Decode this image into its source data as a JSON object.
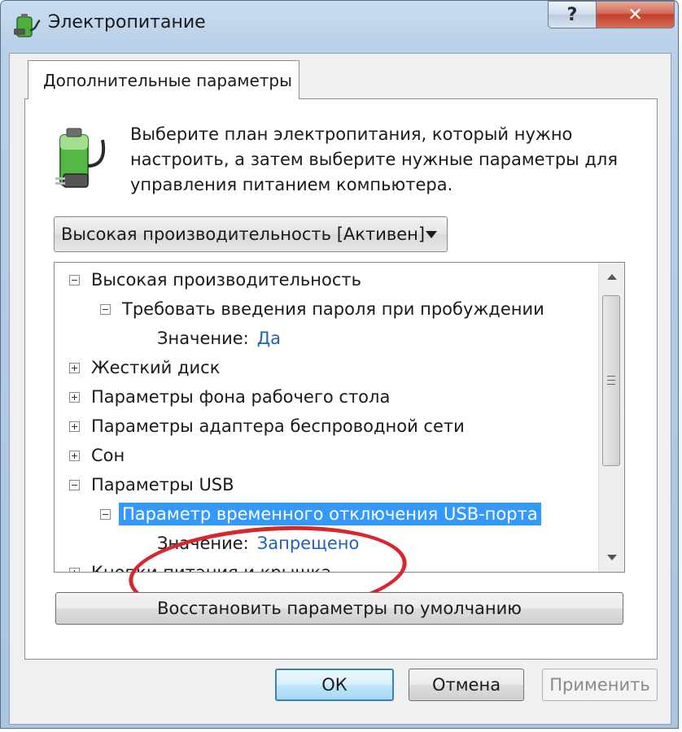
{
  "window": {
    "title": "Электропитание",
    "help_label": "?",
    "close_label": "✕"
  },
  "tab": {
    "label": "Дополнительные параметры"
  },
  "description": "Выберите план электропитания, который нужно настроить, а затем выберите нужные параметры для управления питанием компьютера.",
  "plan_select": {
    "selected": "Высокая производительность [Активен]"
  },
  "tree": {
    "items": [
      {
        "label": "Высокая производительность",
        "expanded": true,
        "level": 0
      },
      {
        "label": "Требовать введения пароля при пробуждении",
        "expanded": true,
        "level": 1
      },
      {
        "value_label": "Значение:",
        "value": "Да",
        "level": 2
      },
      {
        "label": "Жесткий диск",
        "expanded": false,
        "level": 0
      },
      {
        "label": "Параметры фона рабочего стола",
        "expanded": false,
        "level": 0
      },
      {
        "label": "Параметры адаптера беспроводной сети",
        "expanded": false,
        "level": 0
      },
      {
        "label": "Сон",
        "expanded": false,
        "level": 0
      },
      {
        "label": "Параметры USB",
        "expanded": true,
        "level": 0
      },
      {
        "label": "Параметр временного отключения USB-порта",
        "expanded": true,
        "level": 1,
        "selected": true
      },
      {
        "value_label": "Значение:",
        "value": "Запрещено",
        "level": 2
      },
      {
        "label": "Кнопки питания и крышка",
        "expanded": false,
        "level": 0
      }
    ]
  },
  "buttons": {
    "restore_defaults": "Восстановить параметры по умолчанию",
    "ok": "ОК",
    "cancel": "Отмена",
    "apply": "Применить"
  },
  "colors": {
    "selection": "#3399ff",
    "value_link": "#1e64b4",
    "annotation_circle": "#d8262f"
  }
}
